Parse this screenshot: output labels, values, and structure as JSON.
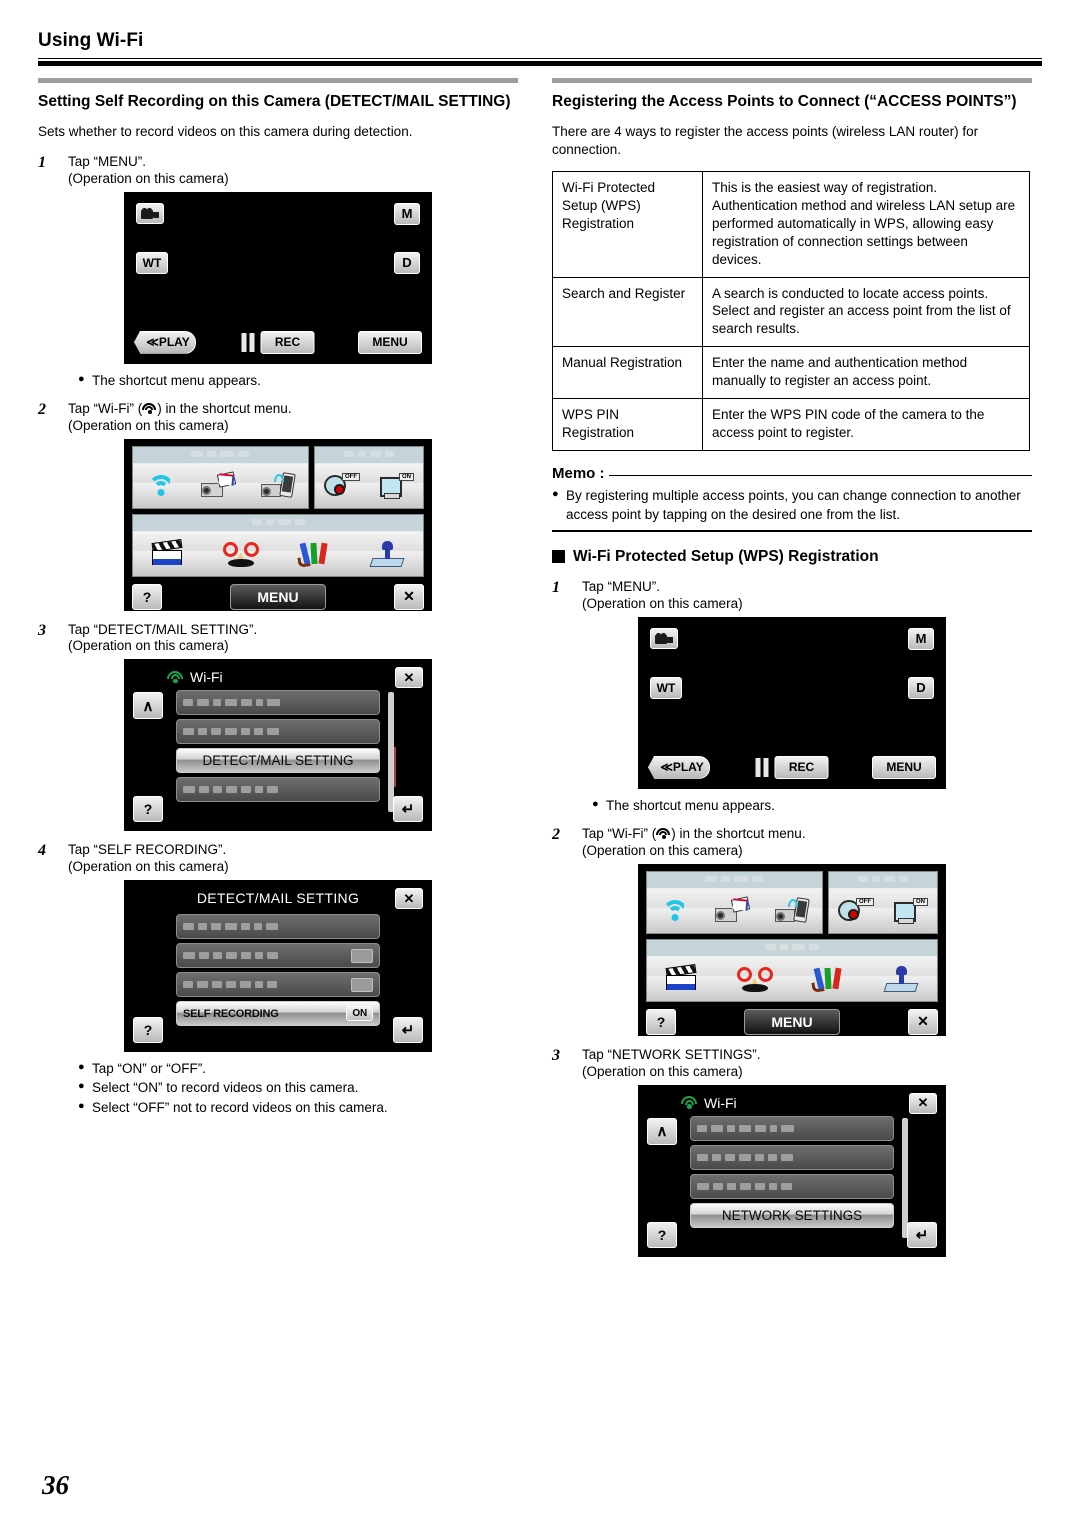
{
  "running_head": {
    "title": "Using Wi-Fi"
  },
  "page_number": "36",
  "left_column": {
    "section_title": "Setting Self Recording on this Camera (DETECT/MAIL SETTING)",
    "intro": "Sets whether to record videos on this camera during detection.",
    "steps": [
      {
        "num": "1",
        "text": "Tap “MENU”.",
        "sub": "(Operation on this camera)"
      },
      {
        "num": "2",
        "text_before": "Tap “Wi-Fi” (",
        "text_after": ") in the shortcut menu.",
        "sub": "(Operation on this camera)"
      },
      {
        "num": "3",
        "text": "Tap “DETECT/MAIL SETTING”.",
        "sub": "(Operation on this camera)"
      },
      {
        "num": "4",
        "text": "Tap “SELF RECORDING”.",
        "sub": "(Operation on this camera)"
      }
    ],
    "after_step1_bullet": "The shortcut menu appears.",
    "final_bullets": [
      "Tap “ON” or “OFF”.",
      "Select “ON” to record videos on this camera.",
      "Select “OFF” not to record videos on this camera."
    ]
  },
  "right_column": {
    "section_title": "Registering the Access Points to Connect (“ACCESS POINTS”)",
    "intro": "There are 4 ways to register the access points (wireless LAN router) for connection.",
    "table": {
      "rows": [
        {
          "method": "Wi-Fi Protected Setup (WPS) Registration",
          "description": "This is the easiest way of registration. Authentication method and wireless LAN setup are performed automatically in WPS, allowing easy registration of connection settings between devices."
        },
        {
          "method": "Search and Register",
          "description": "A search is conducted to locate access points. Select and register an access point from the list of search results."
        },
        {
          "method": "Manual Registration",
          "description": "Enter the name and authentication method manually to register an access point."
        },
        {
          "method": "WPS PIN Registration",
          "description": "Enter the WPS PIN code of the camera to the access point to register."
        }
      ]
    },
    "memo": {
      "label": "Memo :",
      "bullets": [
        "By registering multiple access points, you can change connection to another access point by tapping on the desired one from the list."
      ]
    },
    "sub_heading": "Wi-Fi Protected Setup (WPS) Registration",
    "steps": [
      {
        "num": "1",
        "text": "Tap “MENU”.",
        "sub": "(Operation on this camera)"
      },
      {
        "num": "2",
        "text_before": "Tap “Wi-Fi” (",
        "text_after": ") in the shortcut menu.",
        "sub": "(Operation on this camera)"
      },
      {
        "num": "3",
        "text": "Tap “NETWORK SETTINGS”.",
        "sub": "(Operation on this camera)"
      }
    ],
    "after_step1_bullet": "The shortcut menu appears."
  },
  "screens": {
    "rec_screen": {
      "mode_label": "M",
      "d_label": "D",
      "wt_label": "WT",
      "play_label": "≪PLAY",
      "rec_label": "REC",
      "menu_label": "MENU"
    },
    "shortcut_menu": {
      "menu_label": "MENU",
      "help_label": "?",
      "close_label": "✕",
      "icons": [
        "wifi-icon",
        "mail-camera-icon",
        "camera-phone-icon",
        "rec-off-icon",
        "size-on-icon",
        "clapperboard-icon",
        "glasses-mustache-icon",
        "pencils-icon",
        "stamp-icon"
      ]
    },
    "wifi_list_detect": {
      "title": "Wi-Fi",
      "highlighted_item": "DETECT/MAIL SETTING",
      "close_label": "✕",
      "up_label": "∧",
      "help_label": "?",
      "back_label": "↵"
    },
    "detect_mail_setting": {
      "title": "DETECT/MAIL SETTING",
      "highlighted_item": "SELF RECORDING",
      "toggle_value": "ON",
      "close_label": "✕",
      "help_label": "?",
      "back_label": "↵"
    },
    "wifi_list_network": {
      "title": "Wi-Fi",
      "highlighted_item": "NETWORK SETTINGS",
      "close_label": "✕",
      "up_label": "∧",
      "help_label": "?",
      "back_label": "↵"
    }
  },
  "colors": {
    "rule_gray": "#9d9d9d",
    "wifi_cyan": "#19c6ea",
    "wifi_green": "#18a64a",
    "screen_black": "#000000"
  }
}
